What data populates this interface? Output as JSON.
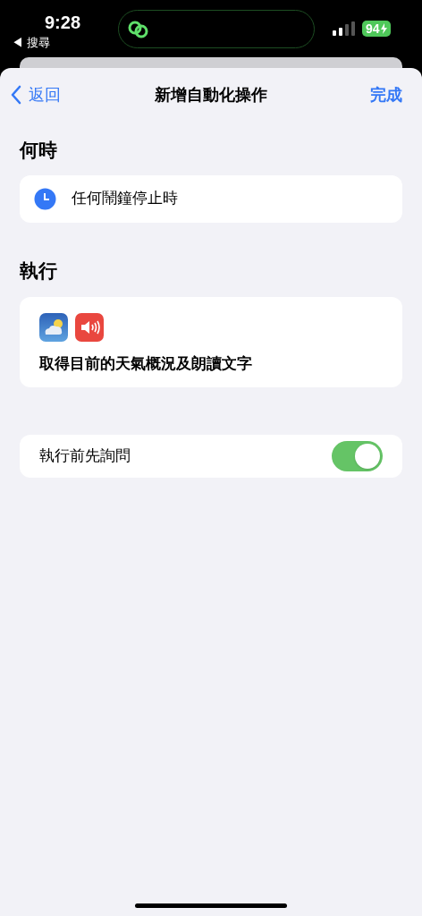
{
  "status_bar": {
    "time": "9:28",
    "back_app": "◀ 搜尋",
    "battery": "94"
  },
  "nav": {
    "back": "返回",
    "title": "新增自動化操作",
    "done": "完成"
  },
  "when": {
    "header": "何時",
    "trigger": "任何鬧鐘停止時"
  },
  "run": {
    "header": "執行",
    "actions": [
      {
        "kind": "weather"
      },
      {
        "kind": "speak"
      }
    ],
    "description": "取得目前的天氣概況及朗讀文字"
  },
  "ask": {
    "label": "執行前先詢問",
    "on": true
  }
}
